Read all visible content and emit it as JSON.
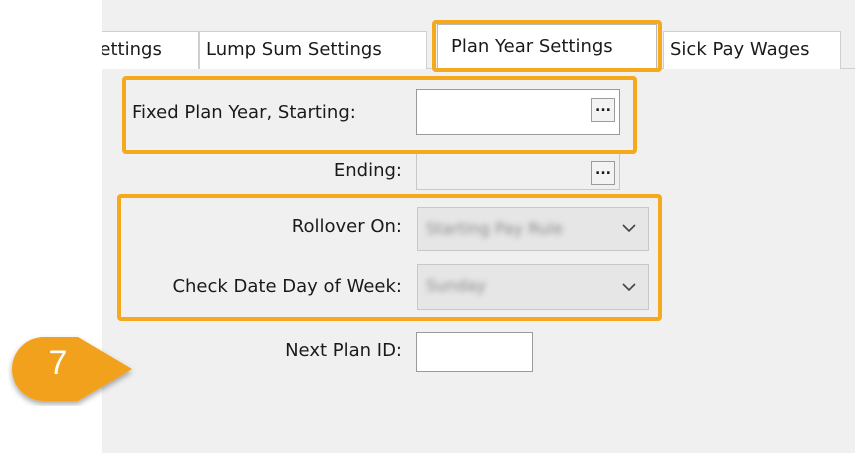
{
  "tabs": [
    {
      "label": "Settings",
      "visible_text": "Settings"
    },
    {
      "label": "Lump Sum Settings"
    },
    {
      "label": "Plan Year Settings",
      "active": true
    },
    {
      "label": "Sick Pay Wages"
    }
  ],
  "form": {
    "fixed_plan_year_label": "Fixed Plan Year, Starting:",
    "fixed_plan_year_value": "",
    "fixed_plan_year_button": "...",
    "ending_label": "Ending:",
    "ending_value": "",
    "ending_button": "...",
    "rollover_label": "Rollover On:",
    "rollover_value": "Starting Pay Rule",
    "check_date_label": "Check Date Day of Week:",
    "check_date_value": "Sunday",
    "next_plan_id_label": "Next Plan ID:",
    "next_plan_id_value": ""
  },
  "callout": {
    "step": "7"
  },
  "colors": {
    "highlight": "#f5a91c",
    "panel_bg": "#f0f0f0"
  }
}
